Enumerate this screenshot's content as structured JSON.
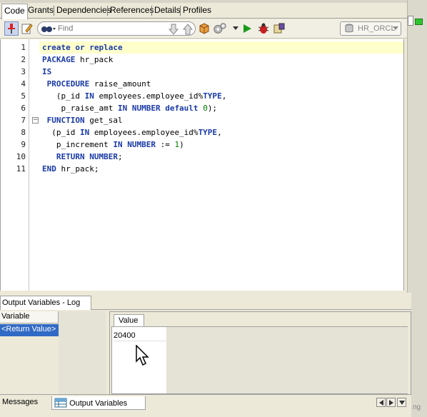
{
  "tabs": [
    "Code",
    "Grants",
    "Dependencies",
    "References",
    "Details",
    "Profiles"
  ],
  "toolbar": {
    "search_placeholder": "Find",
    "connection": "HR_ORCL"
  },
  "code": {
    "lines": [
      {
        "n": "1",
        "parts": [
          {
            "t": "create or replace",
            "c": "kw"
          }
        ]
      },
      {
        "n": "2",
        "parts": [
          {
            "t": "PACKAGE",
            "c": "kw"
          },
          {
            "t": " hr_pack",
            "c": "plain"
          }
        ]
      },
      {
        "n": "3",
        "parts": [
          {
            "t": "IS",
            "c": "kw"
          }
        ]
      },
      {
        "n": "4",
        "parts": [
          {
            "t": " PROCEDURE",
            "c": "kw"
          },
          {
            "t": " raise_amount",
            "c": "plain"
          }
        ]
      },
      {
        "n": "5",
        "parts": [
          {
            "t": "   (p_id ",
            "c": "plain"
          },
          {
            "t": "IN",
            "c": "kw"
          },
          {
            "t": " employees.employee_id%",
            "c": "plain"
          },
          {
            "t": "TYPE",
            "c": "kw"
          },
          {
            "t": ",",
            "c": "plain"
          }
        ]
      },
      {
        "n": "6",
        "parts": [
          {
            "t": "    p_raise_amt ",
            "c": "plain"
          },
          {
            "t": "IN NUMBER default",
            "c": "kw"
          },
          {
            "t": " ",
            "c": "plain"
          },
          {
            "t": "0",
            "c": "num"
          },
          {
            "t": ");",
            "c": "plain"
          }
        ]
      },
      {
        "n": "7",
        "parts": [
          {
            "t": " FUNCTION",
            "c": "kw"
          },
          {
            "t": " get_sal",
            "c": "plain"
          }
        ]
      },
      {
        "n": "8",
        "parts": [
          {
            "t": "  (p_id ",
            "c": "plain"
          },
          {
            "t": "IN",
            "c": "kw"
          },
          {
            "t": " employees.employee_id%",
            "c": "plain"
          },
          {
            "t": "TYPE",
            "c": "kw"
          },
          {
            "t": ",",
            "c": "plain"
          }
        ]
      },
      {
        "n": "9",
        "parts": [
          {
            "t": "   p_increment ",
            "c": "plain"
          },
          {
            "t": "IN NUMBER",
            "c": "kw"
          },
          {
            "t": " := ",
            "c": "plain"
          },
          {
            "t": "1",
            "c": "num"
          },
          {
            "t": ")",
            "c": "plain"
          }
        ]
      },
      {
        "n": "10",
        "parts": [
          {
            "t": "   RETURN NUMBER",
            "c": "kw"
          },
          {
            "t": ";",
            "c": "plain"
          }
        ]
      },
      {
        "n": "11",
        "parts": [
          {
            "t": "END",
            "c": "kw"
          },
          {
            "t": " hr_pack;",
            "c": "plain"
          }
        ]
      }
    ]
  },
  "output_panel": {
    "title": "Output Variables - Log",
    "variable_header": "Variable",
    "selected_variable": "<Return Value>",
    "value_tab": "Value",
    "value": "20400"
  },
  "bottom_tabs": {
    "messages": "Messages",
    "output_variables": "Output Variables"
  },
  "corner_text": "ng"
}
